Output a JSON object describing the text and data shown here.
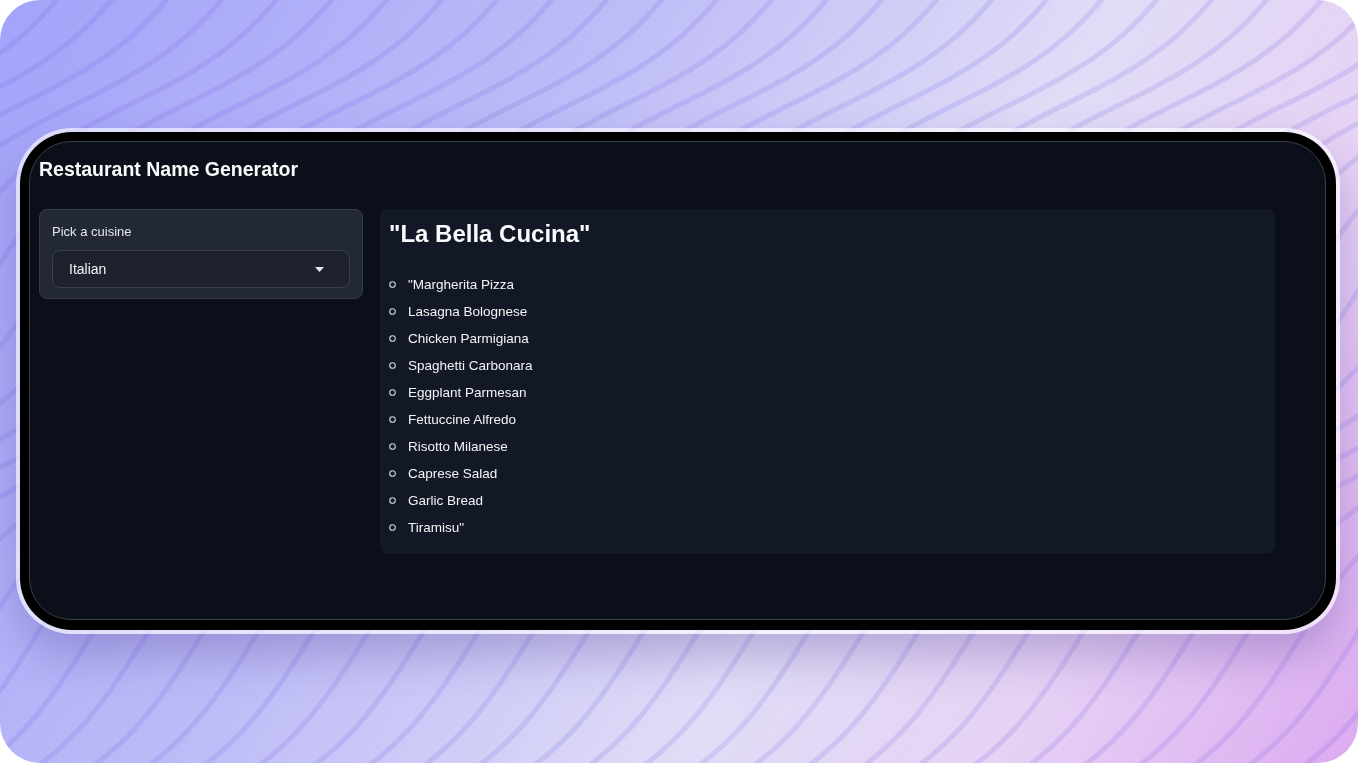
{
  "window": {
    "title": "Restaurant Name Generator"
  },
  "cuisine_select": {
    "label": "Pick a cuisine",
    "value": "Italian"
  },
  "result": {
    "heading": "\"La Bella Cucina\"",
    "items": [
      "\"Margherita Pizza",
      "Lasagna Bolognese",
      "Chicken Parmigiana",
      "Spaghetti Carbonara",
      "Eggplant Parmesan",
      "Fettuccine Alfredo",
      "Risotto Milanese",
      "Caprese Salad",
      "Garlic Bread",
      "Tiramisu\""
    ]
  }
}
